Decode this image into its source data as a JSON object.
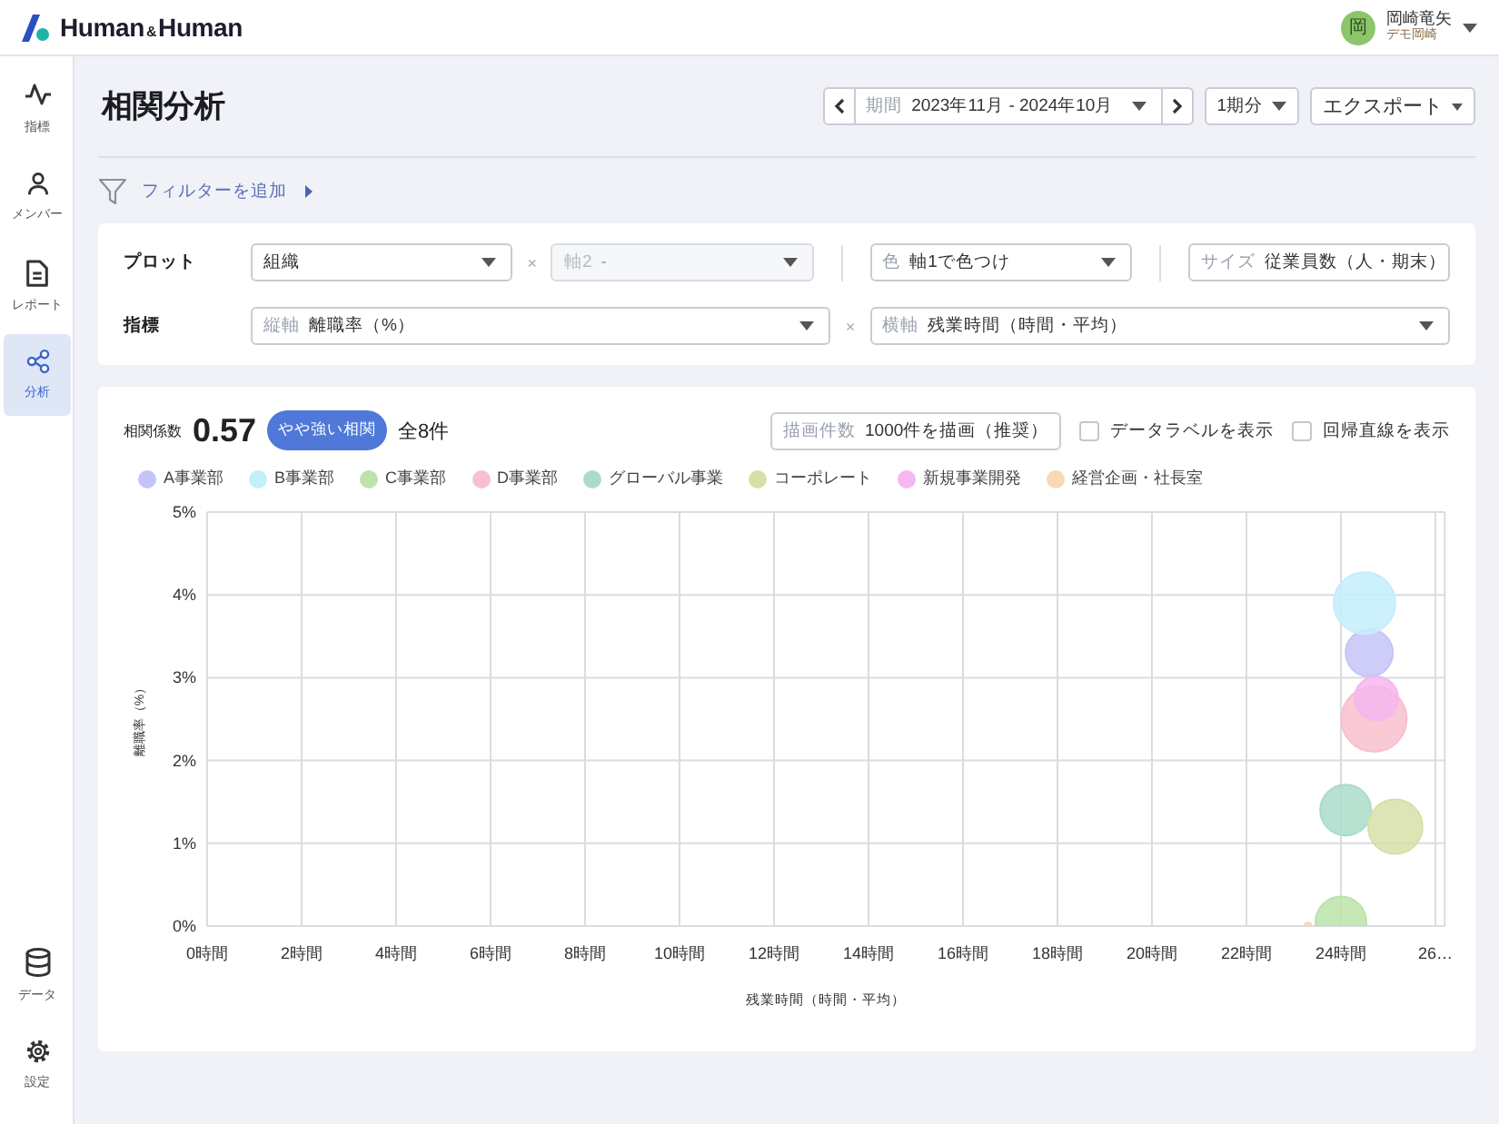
{
  "header": {
    "logo": [
      "Human",
      "&",
      "Human"
    ],
    "user": {
      "avatar": "岡",
      "name": "岡崎竜矢",
      "org": "デモ岡崎"
    }
  },
  "sidebar": {
    "items": [
      {
        "label": "指標",
        "kind": "pulse",
        "selected": false
      },
      {
        "label": "メンバー",
        "kind": "person",
        "selected": false
      },
      {
        "label": "レポート",
        "kind": "document",
        "selected": false
      },
      {
        "label": "分析",
        "kind": "share",
        "selected": true
      }
    ],
    "bottom_items": [
      {
        "label": "データ",
        "kind": "database"
      },
      {
        "label": "設定",
        "kind": "gear"
      }
    ]
  },
  "page": {
    "title": "相関分析",
    "period": {
      "label": "期間",
      "value": "2023年11月 - 2024年10月"
    },
    "span": "1期分",
    "export": "エクスポート"
  },
  "filter": {
    "label": "フィルターを追加"
  },
  "settings": {
    "rows": [
      {
        "label": "プロット",
        "fields": [
          {
            "kind": "select",
            "value": "組織",
            "disabled": false
          },
          {
            "kind": "times",
            "text": "×"
          },
          {
            "kind": "select",
            "label": "軸2",
            "value": "-",
            "disabled": true
          },
          {
            "kind": "divider"
          },
          {
            "kind": "select",
            "label": "色",
            "value": "軸1で色つけ",
            "disabled": false
          },
          {
            "kind": "divider"
          },
          {
            "kind": "select",
            "label": "サイズ",
            "value": "従業員数（人・期末）",
            "disabled": false
          }
        ]
      },
      {
        "label": "指標",
        "fields": [
          {
            "kind": "select",
            "label": "縦軸",
            "value": "離職率（%）",
            "disabled": false
          },
          {
            "kind": "times",
            "text": "×"
          },
          {
            "kind": "select",
            "label": "横軸",
            "value": "残業時間（時間・平均）",
            "disabled": false
          }
        ]
      }
    ]
  },
  "chart": {
    "summary": {
      "label": "相関係数",
      "value": "0.57",
      "badge": "やや強い相関",
      "count": "全8件"
    },
    "draw_count": {
      "label": "描画件数",
      "value": "1000件を描画（推奨）"
    },
    "toggles": [
      {
        "label": "データラベルを表示",
        "checked": false
      },
      {
        "label": "回帰直線を表示",
        "checked": false
      }
    ],
    "chart_data": {
      "type": "scatter",
      "grid": true,
      "xlabel": "残業時間（時間・平均）",
      "ylabel": "離職率（%）",
      "xlim": [
        0,
        26.2
      ],
      "ylim": [
        0,
        5
      ],
      "xticks": [
        {
          "value": 0,
          "label": "0時間"
        },
        {
          "value": 2,
          "label": "2時間"
        },
        {
          "value": 4,
          "label": "4時間"
        },
        {
          "value": 6,
          "label": "6時間"
        },
        {
          "value": 8,
          "label": "8時間"
        },
        {
          "value": 10,
          "label": "10時間"
        },
        {
          "value": 12,
          "label": "12時間"
        },
        {
          "value": 14,
          "label": "14時間"
        },
        {
          "value": 16,
          "label": "16時間"
        },
        {
          "value": 18,
          "label": "18時間"
        },
        {
          "value": 20,
          "label": "20時間"
        },
        {
          "value": 22,
          "label": "22時間"
        },
        {
          "value": 24,
          "label": "24時間"
        },
        {
          "value": 26,
          "label": "26…"
        }
      ],
      "yticks": [
        {
          "value": 0,
          "label": "0%"
        },
        {
          "value": 1,
          "label": "1%"
        },
        {
          "value": 2,
          "label": "2%"
        },
        {
          "value": 3,
          "label": "3%"
        },
        {
          "value": 4,
          "label": "4%"
        },
        {
          "value": 5,
          "label": "5%"
        }
      ],
      "series": [
        {
          "name": "A事業部",
          "color": "#c4c4f7",
          "x": [
            24.6
          ],
          "values": [
            3.3
          ]
        },
        {
          "name": "B事業部",
          "color": "#c4eefb",
          "x": [
            24.5
          ],
          "values": [
            3.9
          ]
        },
        {
          "name": "C事業部",
          "color": "#bce3a9",
          "x": [
            24.0
          ],
          "values": [
            0.05
          ]
        },
        {
          "name": "D事業部",
          "color": "#f8c0cd",
          "x": [
            24.7
          ],
          "values": [
            2.5
          ]
        },
        {
          "name": "グローバル事業",
          "color": "#aadcc9",
          "x": [
            24.1
          ],
          "values": [
            1.4
          ]
        },
        {
          "name": "コーポレート",
          "color": "#d7dfa9",
          "x": [
            25.15
          ],
          "values": [
            1.2
          ]
        },
        {
          "name": "新規事業開発",
          "color": "#f6b6ef",
          "x": [
            24.75
          ],
          "values": [
            2.75
          ]
        },
        {
          "name": "経営企画・社長室",
          "color": "#f9d8b6",
          "x": [
            23.3
          ],
          "values": [
            0.0
          ]
        }
      ]
    }
  }
}
